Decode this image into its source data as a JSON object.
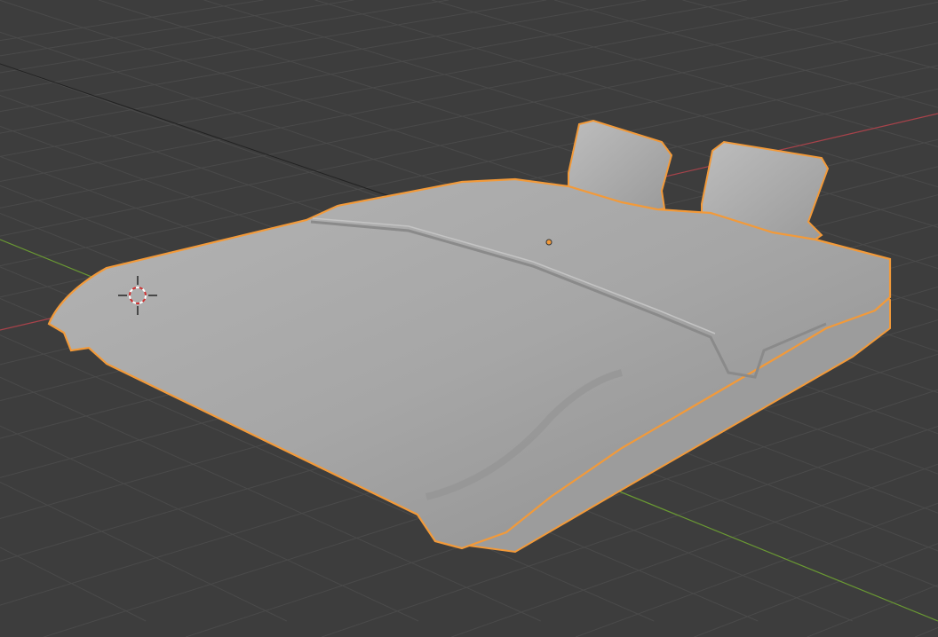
{
  "viewport": {
    "background_color": "#3d3d3d",
    "grid_color": "#4a4a4a",
    "x_axis_color": "#a8424a",
    "y_axis_color": "#6a9a32",
    "selection_outline_color": "#f29a3a",
    "mesh_color": "#a9a9a9",
    "object_name_visible": false
  },
  "icons": {
    "cursor": "3d-cursor-icon",
    "origin": "object-origin-icon"
  }
}
